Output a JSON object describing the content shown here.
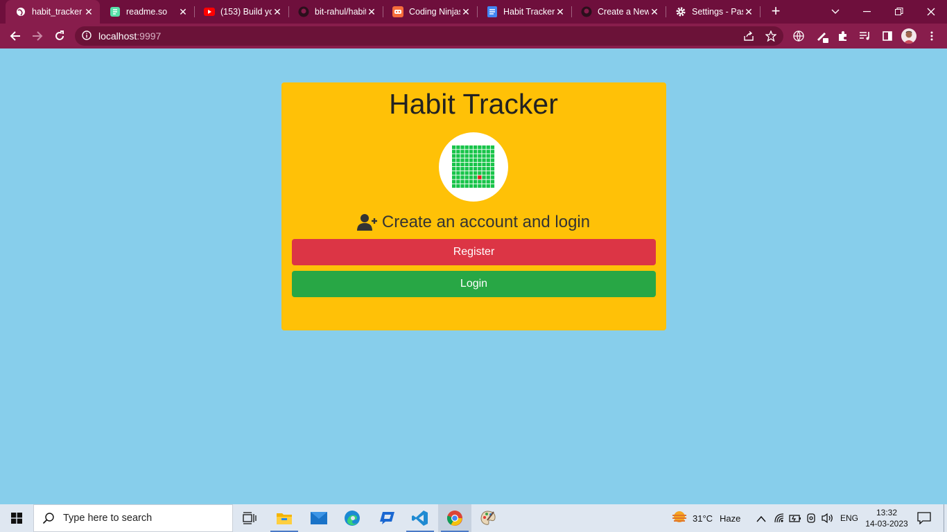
{
  "browser": {
    "tabs": [
      {
        "title": "habit_tracker",
        "icon": "globe-icon",
        "active": true
      },
      {
        "title": "readme.so",
        "icon": "readme-icon"
      },
      {
        "title": "(153) Build yo",
        "icon": "youtube-icon"
      },
      {
        "title": "bit-rahul/habit",
        "icon": "github-icon"
      },
      {
        "title": "Coding Ninjas",
        "icon": "coding-ninjas-icon"
      },
      {
        "title": "Habit Tracker",
        "icon": "docs-icon"
      },
      {
        "title": "Create a New",
        "icon": "github-icon"
      },
      {
        "title": "Settings - Pas",
        "icon": "gear-icon"
      }
    ],
    "url_host": "localhost",
    "url_port": ":9997"
  },
  "page": {
    "title": "Habit Tracker",
    "subtitle": "Create an account and login",
    "register_label": "Register",
    "login_label": "Login",
    "colors": {
      "background": "#87ceeb",
      "card": "#ffc107",
      "register": "#dc3545",
      "login": "#28a745"
    }
  },
  "taskbar": {
    "search_placeholder": "Type here to search",
    "weather_temp": "31°C",
    "weather_desc": "Haze",
    "language": "ENG",
    "time": "13:32",
    "date": "14-03-2023"
  }
}
